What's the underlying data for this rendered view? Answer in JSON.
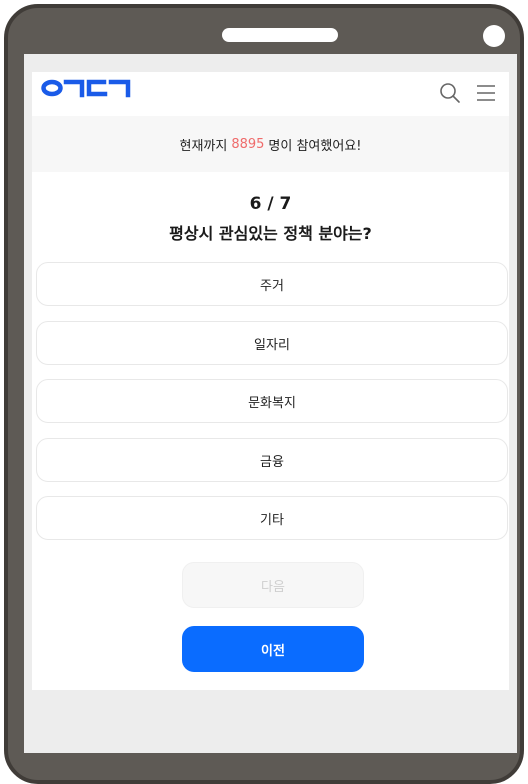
{
  "header": {
    "logo": "ㅇㄱㄷㄱ",
    "search_icon": "search-icon",
    "menu_icon": "hamburger-menu-icon"
  },
  "notice": {
    "prefix": "현재까지",
    "count": "8895",
    "suffix": "명이 참여했어요!"
  },
  "quiz": {
    "progress": "6 / 7",
    "question": "평상시 관심있는 정책 분야는?",
    "options": [
      {
        "label": "주거"
      },
      {
        "label": "일자리"
      },
      {
        "label": "문화복지"
      },
      {
        "label": "금융"
      },
      {
        "label": "기타"
      }
    ]
  },
  "buttons": {
    "next_label": "다음",
    "prev_label": "이전"
  },
  "colors": {
    "brand": "#1a5be8",
    "primary_button": "#0a6cff",
    "count_highlight": "#ef6b6b"
  }
}
